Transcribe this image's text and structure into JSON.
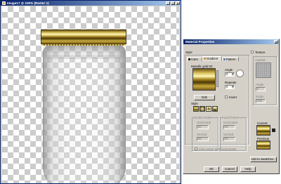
{
  "image_window": {
    "title": "Image17 @ 100% (Raster 1)",
    "minimize": "_",
    "maximize": "□",
    "close": "×"
  },
  "dialog": {
    "title": "Material Properties",
    "close": "×",
    "style_label": "Style",
    "texture_label": "Texture",
    "tabs": [
      {
        "label": "Color",
        "dot_color": "#000000"
      },
      {
        "label": "Gradient",
        "dot_color": "#d08020"
      },
      {
        "label": "Pattern",
        "dot_color": "#6080c0"
      }
    ],
    "gradient_label": "Metallic gold 02",
    "angle_label": "Angle",
    "angle_value": "0",
    "repeats_label": "Repeats",
    "repeats_value": "0",
    "edit_button": "Edit",
    "invert_label": "Invert",
    "style_section_label": "Style",
    "center_point_label": "Center Point",
    "focal_point_label": "Focal Point",
    "horizontal_label": "Horizontal",
    "vertical_label": "Vertical",
    "center_h": "50",
    "center_v": "50",
    "focal_h": "50",
    "focal_v": "50",
    "link_label": "Link center and focal points",
    "texture_preview_label": "Asphalt",
    "tex_angle_label": "Angle",
    "tex_angle_value": "0",
    "tex_scale_label": "Scale",
    "tex_scale_value": "100",
    "current_label": "Current",
    "previous_label": "Previous",
    "add_swatches_button": "Add to swatches...",
    "ok_button": "OK",
    "cancel_button": "Cancel",
    "help_button": "Help"
  }
}
